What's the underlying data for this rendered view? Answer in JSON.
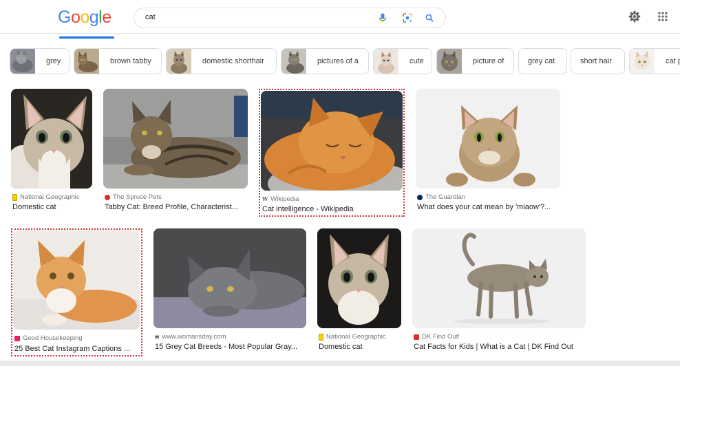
{
  "header": {
    "logo_letters": [
      {
        "ch": "G",
        "color": "#4285F4"
      },
      {
        "ch": "o",
        "color": "#EA4335"
      },
      {
        "ch": "o",
        "color": "#FBBC05"
      },
      {
        "ch": "g",
        "color": "#4285F4"
      },
      {
        "ch": "l",
        "color": "#34A853"
      },
      {
        "ch": "e",
        "color": "#EA4335"
      }
    ],
    "search_query": "cat",
    "icons": [
      "microphone-icon",
      "google-lens-icon",
      "search-icon",
      "settings-gear-icon",
      "apps-grid-icon"
    ]
  },
  "chips": [
    {
      "label": "grey"
    },
    {
      "label": "brown tabby"
    },
    {
      "label": "domestic shorthair"
    },
    {
      "label": "pictures of a"
    },
    {
      "label": "cute"
    },
    {
      "label": "picture of"
    },
    {
      "label": "grey cat"
    },
    {
      "label": "short hair"
    },
    {
      "label": "cat p"
    }
  ],
  "results": [
    {
      "source": "National Geographic",
      "title": "Domestic cat",
      "favicon_color": "#FFCC00",
      "highlighted": false
    },
    {
      "source": "The Spruce Pets",
      "title": "Tabby Cat: Breed Profile, Characterist...",
      "favicon_color": "#d93025",
      "highlighted": false
    },
    {
      "source": "Wikipedia",
      "title": "Cat intelligence - Wikipedia",
      "favicon_color": "#5f6368",
      "highlighted": true
    },
    {
      "source": "The Guardian",
      "title": "What does your cat mean by 'miaow'?...",
      "favicon_color": "#052962",
      "highlighted": false
    },
    {
      "source": "Good Housekeeping",
      "title": "25 Best Cat Instagram Captions ...",
      "favicon_color": "#e91e63",
      "highlighted": true
    },
    {
      "source": "www.womansday.com",
      "title": "15 Grey Cat Breeds - Most Popular Gray...",
      "favicon_color": "#5f6368",
      "highlighted": false
    },
    {
      "source": "National Geographic",
      "title": "Domestic cat",
      "favicon_color": "#FFCC00",
      "highlighted": false
    },
    {
      "source": "DK Find Out!",
      "title": "Cat Facts for Kids | What is a Cat | DK Find Out",
      "favicon_color": "#d93025",
      "highlighted": false
    }
  ]
}
